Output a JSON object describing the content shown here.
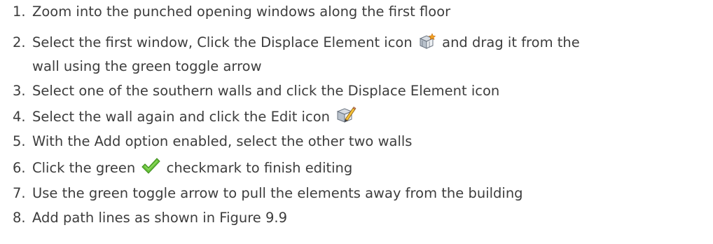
{
  "steps": [
    {
      "num": "1.",
      "text": "Zoom into the punched opening windows along the first floor"
    },
    {
      "num": "2.",
      "text_before_icon": "Select the first window, Click the Displace Element icon",
      "text_after_icon": "and drag it from the",
      "text_cont": "wall using the green toggle arrow",
      "icon": "displace-element-icon"
    },
    {
      "num": "3.",
      "text": "Select one of the southern walls and click the Displace Element icon"
    },
    {
      "num": "4.",
      "text_before_icon": "Select the wall again and click the Edit icon",
      "icon": "edit-icon"
    },
    {
      "num": "5.",
      "text": "With the Add option enabled, select the other two walls"
    },
    {
      "num": "6.",
      "text_before_icon": "Click the green",
      "text_after_icon": "checkmark to finish editing",
      "icon": "green-checkmark-icon"
    },
    {
      "num": "7.",
      "text": "Use the green toggle arrow to pull the elements away from the building"
    },
    {
      "num": "8.",
      "text": "Add path lines as shown in Figure 9.9"
    }
  ],
  "colors": {
    "text": "#3d3d3d",
    "checkmark_green": "#5bb832",
    "icon_orange": "#e88a1a"
  }
}
